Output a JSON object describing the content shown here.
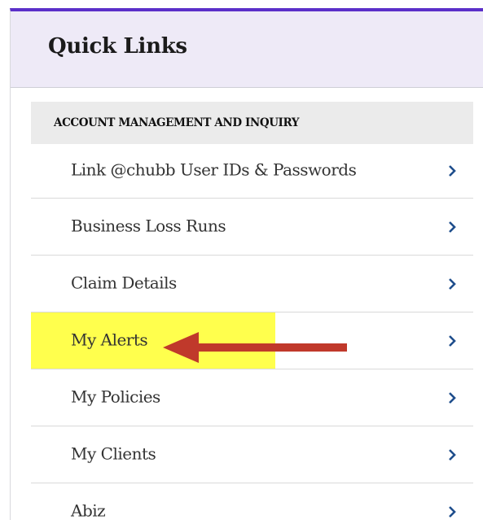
{
  "panel": {
    "title": "Quick Links",
    "accent_color": "#5b2fc9",
    "header_bg": "#eeeaf7"
  },
  "section": {
    "label": "ACCOUNT MANAGEMENT AND INQUIRY"
  },
  "links": [
    {
      "label": "Link @chubb User IDs & Passwords",
      "icon": "chevron-right-icon"
    },
    {
      "label": "Business Loss Runs",
      "icon": "chevron-right-icon"
    },
    {
      "label": "Claim Details",
      "icon": "chevron-right-icon"
    },
    {
      "label": "My Alerts",
      "icon": "chevron-right-icon",
      "highlighted": true,
      "highlight_color": "#ffff4d",
      "annotation": "red-arrow-pointing-left"
    },
    {
      "label": "My Policies",
      "icon": "chevron-right-icon"
    },
    {
      "label": "My Clients",
      "icon": "chevron-right-icon"
    },
    {
      "label": "Abiz",
      "icon": "chevron-right-icon"
    }
  ],
  "colors": {
    "chevron": "#1f4e8c",
    "annotation_arrow": "#c0392b"
  }
}
